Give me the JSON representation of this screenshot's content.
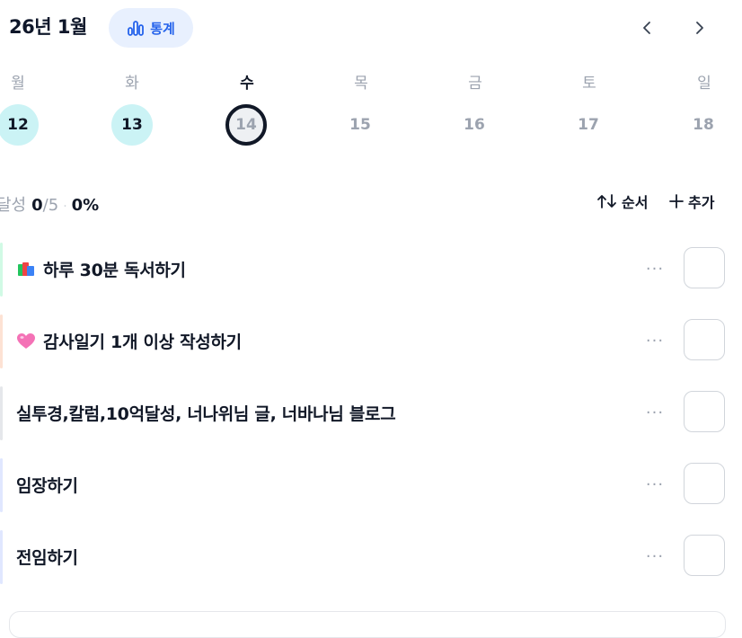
{
  "header": {
    "month_title": "26년 1월",
    "stats_label": "통계"
  },
  "weekdays": [
    "월",
    "화",
    "수",
    "목",
    "금",
    "토",
    "일"
  ],
  "days": [
    "12",
    "13",
    "14",
    "15",
    "16",
    "17",
    "18"
  ],
  "progress": {
    "label": "달성",
    "done": "0",
    "total": "/5",
    "separator": "·",
    "percent": "0%"
  },
  "actions": {
    "order_label": "순서",
    "add_label": "추가"
  },
  "tasks": [
    {
      "text": "하루 30분 독서하기",
      "icon": "books-icon",
      "bar_color": "#d1fae5"
    },
    {
      "text": "감사일기 1개 이상 작성하기",
      "icon": "heart-icon",
      "bar_color": "#fde2d4"
    },
    {
      "text": "실투경,칼럼,10억달성, 너나위님 글, 너바나님 블로그",
      "icon": "",
      "bar_color": "#e5e7eb"
    },
    {
      "text": "임장하기",
      "icon": "",
      "bar_color": "#e0e7ff"
    },
    {
      "text": "전임하기",
      "icon": "",
      "bar_color": "#e0e7ff"
    }
  ],
  "colors": {
    "accent": "#2563eb",
    "stats_bg": "#e8f0fe",
    "done_day_bg": "#cbf3f5",
    "today_ring": "#111827"
  }
}
